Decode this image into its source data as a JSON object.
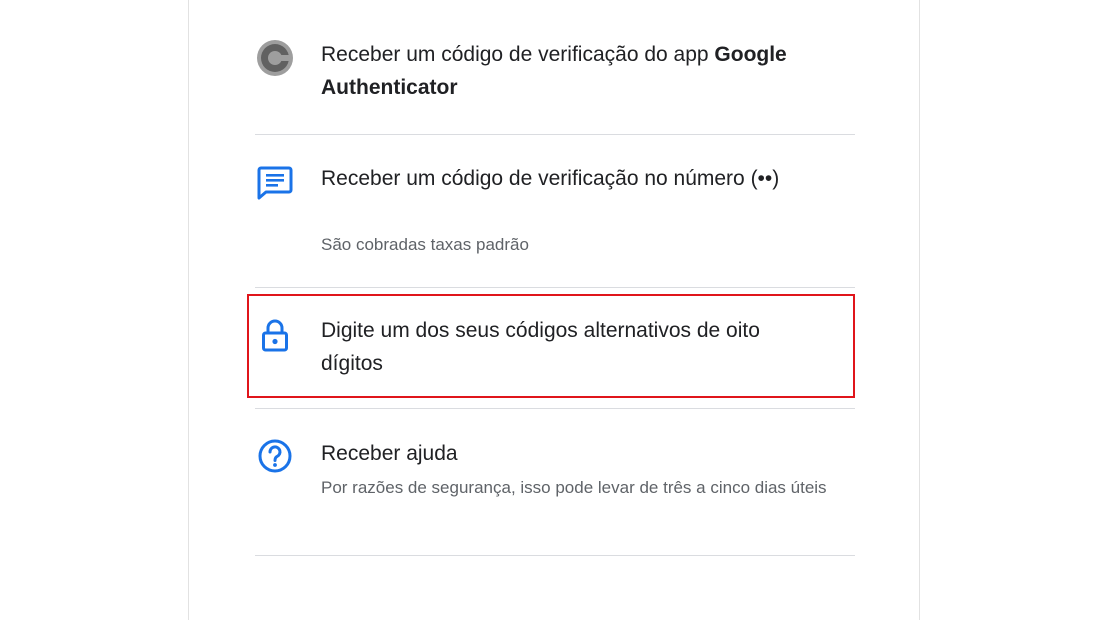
{
  "options": [
    {
      "icon": "google-authenticator-icon",
      "text_prefix": "Receber um código de verificação do app ",
      "text_bold": "Google Authenticator"
    },
    {
      "icon": "sms-message-icon",
      "text": "Receber um código de verificação no número (••)",
      "subtext": "São cobradas taxas padrão"
    },
    {
      "icon": "lock-icon",
      "text": "Digite um dos seus códigos alternativos de oito dígitos"
    },
    {
      "icon": "help-circle-icon",
      "text": "Receber ajuda",
      "subtext": "Por razões de segurança, isso pode levar de três a cinco dias úteis"
    }
  ],
  "colors": {
    "accent": "#1a73e8",
    "highlight_border": "#e0151b",
    "authenticator_dark": "#616161",
    "authenticator_light": "#9e9e9e",
    "primary_text": "#202124",
    "secondary_text": "#5f6368",
    "divider": "#dadce0"
  }
}
